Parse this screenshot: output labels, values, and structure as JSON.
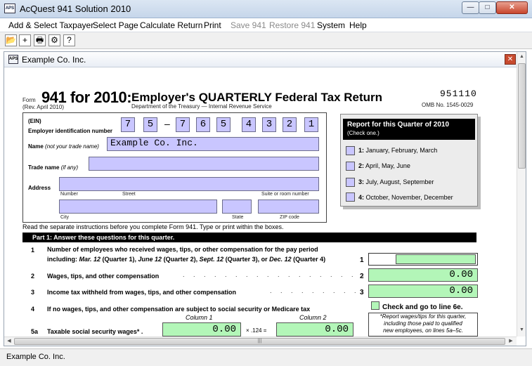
{
  "window": {
    "title": "AcQuest 941 Solution 2010",
    "app_icon_text": "APS",
    "minimize_glyph": "—",
    "maximize_glyph": "□",
    "close_glyph": "✕"
  },
  "menu": [
    {
      "label": "Add & Select Taxpayer",
      "enabled": true
    },
    {
      "label": "Select Page",
      "enabled": true
    },
    {
      "label": "Calculate Return",
      "enabled": true
    },
    {
      "label": "Print",
      "enabled": true
    },
    {
      "label": "Save 941",
      "enabled": false
    },
    {
      "label": "Restore 941",
      "enabled": false
    },
    {
      "label": "System",
      "enabled": true
    },
    {
      "label": "Help",
      "enabled": true
    }
  ],
  "toolbar": [
    {
      "icon": "open-folder-icon",
      "glyph": "📂"
    },
    {
      "icon": "add-icon",
      "glyph": "+"
    },
    {
      "icon": "print-icon",
      "glyph": "🖶"
    },
    {
      "icon": "calculate-icon",
      "glyph": "⚙"
    },
    {
      "icon": "help-icon",
      "glyph": "?"
    }
  ],
  "document": {
    "title": "Example Co. Inc.",
    "icon_text": "APS",
    "close_glyph": "✕"
  },
  "form": {
    "form_word": "Form",
    "form_number": "941 for 2010:",
    "heading": "Employer's QUARTERLY Federal Tax Return",
    "revision": "(Rev. April 2010)",
    "department": "Department of the Treasury — Internal Revenue Service",
    "code": "951110",
    "omb": "OMB No. 1545-0029",
    "ein_label_1": "(EIN)",
    "ein_label_2": "Employer identification number",
    "ein_digits": [
      "7",
      "5",
      "7",
      "6",
      "5",
      "4",
      "3",
      "2",
      "1"
    ],
    "ein_dash": "–",
    "name_label": "Name",
    "name_hint": "(not your trade name)",
    "name_value": "Example Co. Inc.",
    "trade_label": "Trade name",
    "trade_hint": "(if any)",
    "trade_value": "",
    "address_label": "Address",
    "addr_number": "Number",
    "addr_street": "Street",
    "addr_suite": "Suite or room number",
    "addr_city": "City",
    "addr_state": "State",
    "addr_zip": "ZIP code",
    "report_title": "Report for this Quarter of 2010",
    "report_sub": "(Check one.)",
    "quarters": [
      {
        "num": "1:",
        "label": "January, February, March"
      },
      {
        "num": "2:",
        "label": "April, May, June"
      },
      {
        "num": "3:",
        "label": "July, August, September"
      },
      {
        "num": "4:",
        "label": "October, November, December"
      }
    ],
    "instructions": "Read the separate instructions before you complete Form 941. Type or print within the boxes.",
    "part1": "Part 1: Answer these questions for this quarter.",
    "line1_num": "1",
    "line1_text_a": "Number of employees who received wages, tips, or other compensation for the pay period",
    "line1_text_b_pre": "including: ",
    "line1_mar": "Mar. 12",
    "line1_q1": " (Quarter 1), ",
    "line1_jun": "June 12",
    "line1_q2": " (Quarter 2), ",
    "line1_sep": "Sept. 12",
    "line1_q3": " (Quarter 3), or ",
    "line1_dec": "Dec. 12",
    "line1_q4": " (Quarter 4)",
    "line1_value": "",
    "line2_num": "2",
    "line2_text": "Wages, tips, and other compensation",
    "line2_value": "0.00",
    "line3_num": "3",
    "line3_text": "Income tax withheld from wages, tips, and other compensation",
    "line3_value": "0.00",
    "line4_num": "4",
    "line4_text": "If no wages, tips, and other compensation are subject to social security or Medicare tax",
    "line4_check": "Check and go to line 6e.",
    "col1": "Column 1",
    "col2": "Column 2",
    "line5a_num": "5a",
    "line5a_text": "Taxable social security wages* .",
    "line5a_col1": "0.00",
    "line5a_mult": "× .124 =",
    "line5a_col2": "0.00",
    "note_l1": "*Report wages/tips for this quarter,",
    "note_l2": "including those paid to qualified",
    "note_l3": "new employees, on lines 5a–5c."
  },
  "status": {
    "text": "Example Co. Inc."
  }
}
